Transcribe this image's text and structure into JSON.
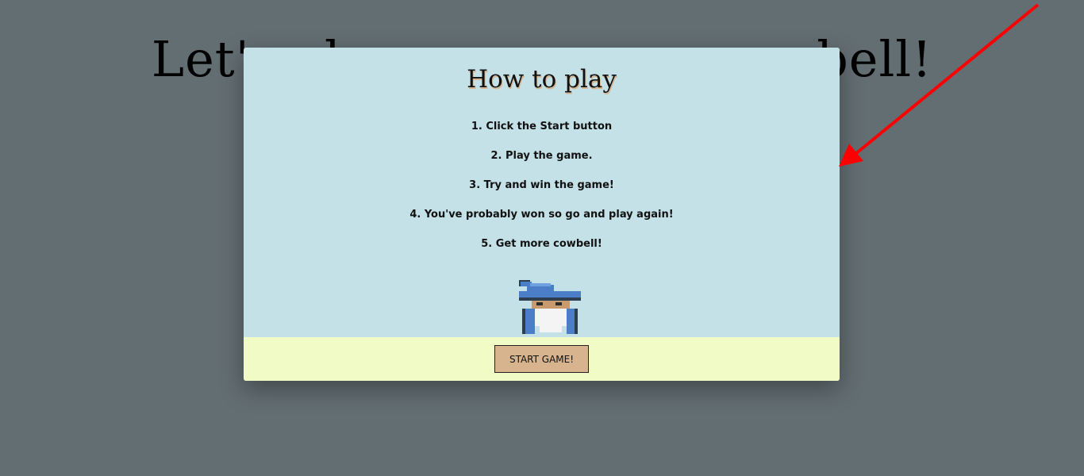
{
  "background": {
    "title": "Let's play some more cowbell!"
  },
  "modal": {
    "title": "How to play",
    "steps": [
      "1. Click the Start button",
      "2. Play the game.",
      "3. Try and win the game!",
      "4. You've probably won so go and play again!",
      "5. Get more cowbell!"
    ],
    "mascot_icon": "wizard-icon",
    "start_button_label": "START GAME!"
  },
  "colors": {
    "page_background": "#636e72",
    "modal_background": "#c4e1e7",
    "footer_background": "#f0fbc6",
    "button_background": "#d8b48e",
    "annotation_arrow": "#ff0000"
  }
}
